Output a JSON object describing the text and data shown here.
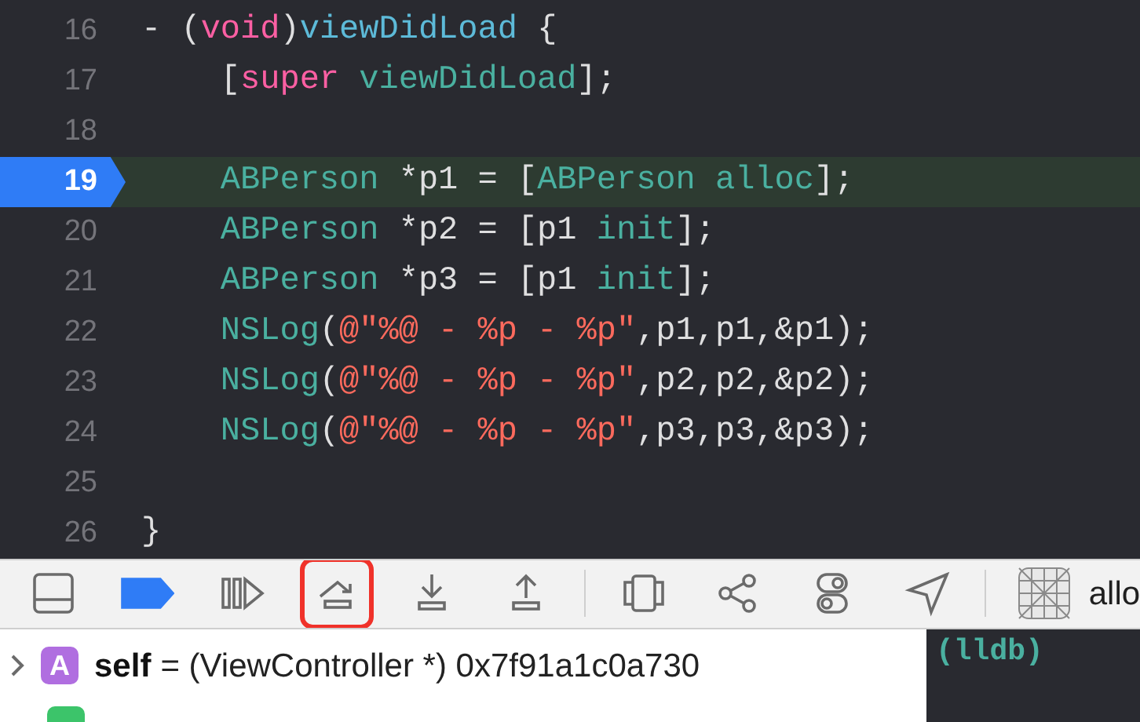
{
  "editor": {
    "lines": [
      {
        "number": "16",
        "current": false,
        "tokens": [
          {
            "kind": "plain",
            "text": "- ("
          },
          {
            "kind": "keyword",
            "text": "void"
          },
          {
            "kind": "plain",
            "text": ")"
          },
          {
            "kind": "decl",
            "text": "viewDidLoad"
          },
          {
            "kind": "plain",
            "text": " {"
          }
        ]
      },
      {
        "number": "17",
        "current": false,
        "tokens": [
          {
            "kind": "plain",
            "text": "    ["
          },
          {
            "kind": "keyword",
            "text": "super"
          },
          {
            "kind": "method",
            "text": " viewDidLoad"
          },
          {
            "kind": "plain",
            "text": "];"
          }
        ]
      },
      {
        "number": "18",
        "current": false
      },
      {
        "number": "19",
        "current": true,
        "tokens": [
          {
            "kind": "method",
            "text": "    ABPerson"
          },
          {
            "kind": "plain",
            "text": " *p1 = ["
          },
          {
            "kind": "method",
            "text": "ABPerson alloc"
          },
          {
            "kind": "plain",
            "text": "];"
          }
        ]
      },
      {
        "number": "20",
        "current": false,
        "tokens": [
          {
            "kind": "method",
            "text": "    ABPerson"
          },
          {
            "kind": "plain",
            "text": " *p2 = [p1 "
          },
          {
            "kind": "method",
            "text": "init"
          },
          {
            "kind": "plain",
            "text": "];"
          }
        ]
      },
      {
        "number": "21",
        "current": false,
        "tokens": [
          {
            "kind": "method",
            "text": "    ABPerson"
          },
          {
            "kind": "plain",
            "text": " *p3 = [p1 "
          },
          {
            "kind": "method",
            "text": "init"
          },
          {
            "kind": "plain",
            "text": "];"
          }
        ]
      },
      {
        "number": "22",
        "current": false,
        "tokens": [
          {
            "kind": "method",
            "text": "    NSLog"
          },
          {
            "kind": "plain",
            "text": "("
          },
          {
            "kind": "string",
            "text": "@\"%@ - %p - %p\""
          },
          {
            "kind": "plain",
            "text": ",p1,p1,&p1);"
          }
        ]
      },
      {
        "number": "23",
        "current": false,
        "tokens": [
          {
            "kind": "method",
            "text": "    NSLog"
          },
          {
            "kind": "plain",
            "text": "("
          },
          {
            "kind": "string",
            "text": "@\"%@ - %p - %p\""
          },
          {
            "kind": "plain",
            "text": ",p2,p2,&p2);"
          }
        ]
      },
      {
        "number": "24",
        "current": false,
        "tokens": [
          {
            "kind": "method",
            "text": "    NSLog"
          },
          {
            "kind": "plain",
            "text": "("
          },
          {
            "kind": "string",
            "text": "@\"%@ - %p - %p\""
          },
          {
            "kind": "plain",
            "text": ",p3,p3,&p3);"
          }
        ]
      },
      {
        "number": "25",
        "current": false
      },
      {
        "number": "26",
        "current": false,
        "tokens": [
          {
            "kind": "plain",
            "text": "}"
          }
        ]
      }
    ]
  },
  "debug_bar": {
    "tools": [
      {
        "kind": "panel",
        "outlined": false
      },
      {
        "kind": "breakpoints",
        "active": true,
        "outlined": false
      },
      {
        "kind": "continue",
        "outlined": false
      },
      {
        "kind": "step-over",
        "outlined": true
      },
      {
        "kind": "step-into",
        "outlined": false
      },
      {
        "kind": "step-out",
        "outlined": false
      },
      {
        "kind": "divider"
      },
      {
        "kind": "view-hierarchy",
        "outlined": false
      },
      {
        "kind": "memory-graph",
        "outlined": false
      },
      {
        "kind": "environment",
        "outlined": false
      },
      {
        "kind": "location",
        "outlined": false
      },
      {
        "kind": "divider"
      },
      {
        "kind": "frame",
        "outlined": false
      }
    ],
    "frame_label": "allo"
  },
  "variables": [
    {
      "badge": "A",
      "name": "self",
      "value": "= (ViewController *) 0x7f91a1c0a730"
    }
  ],
  "console": {
    "prompt": "(lldb)"
  }
}
